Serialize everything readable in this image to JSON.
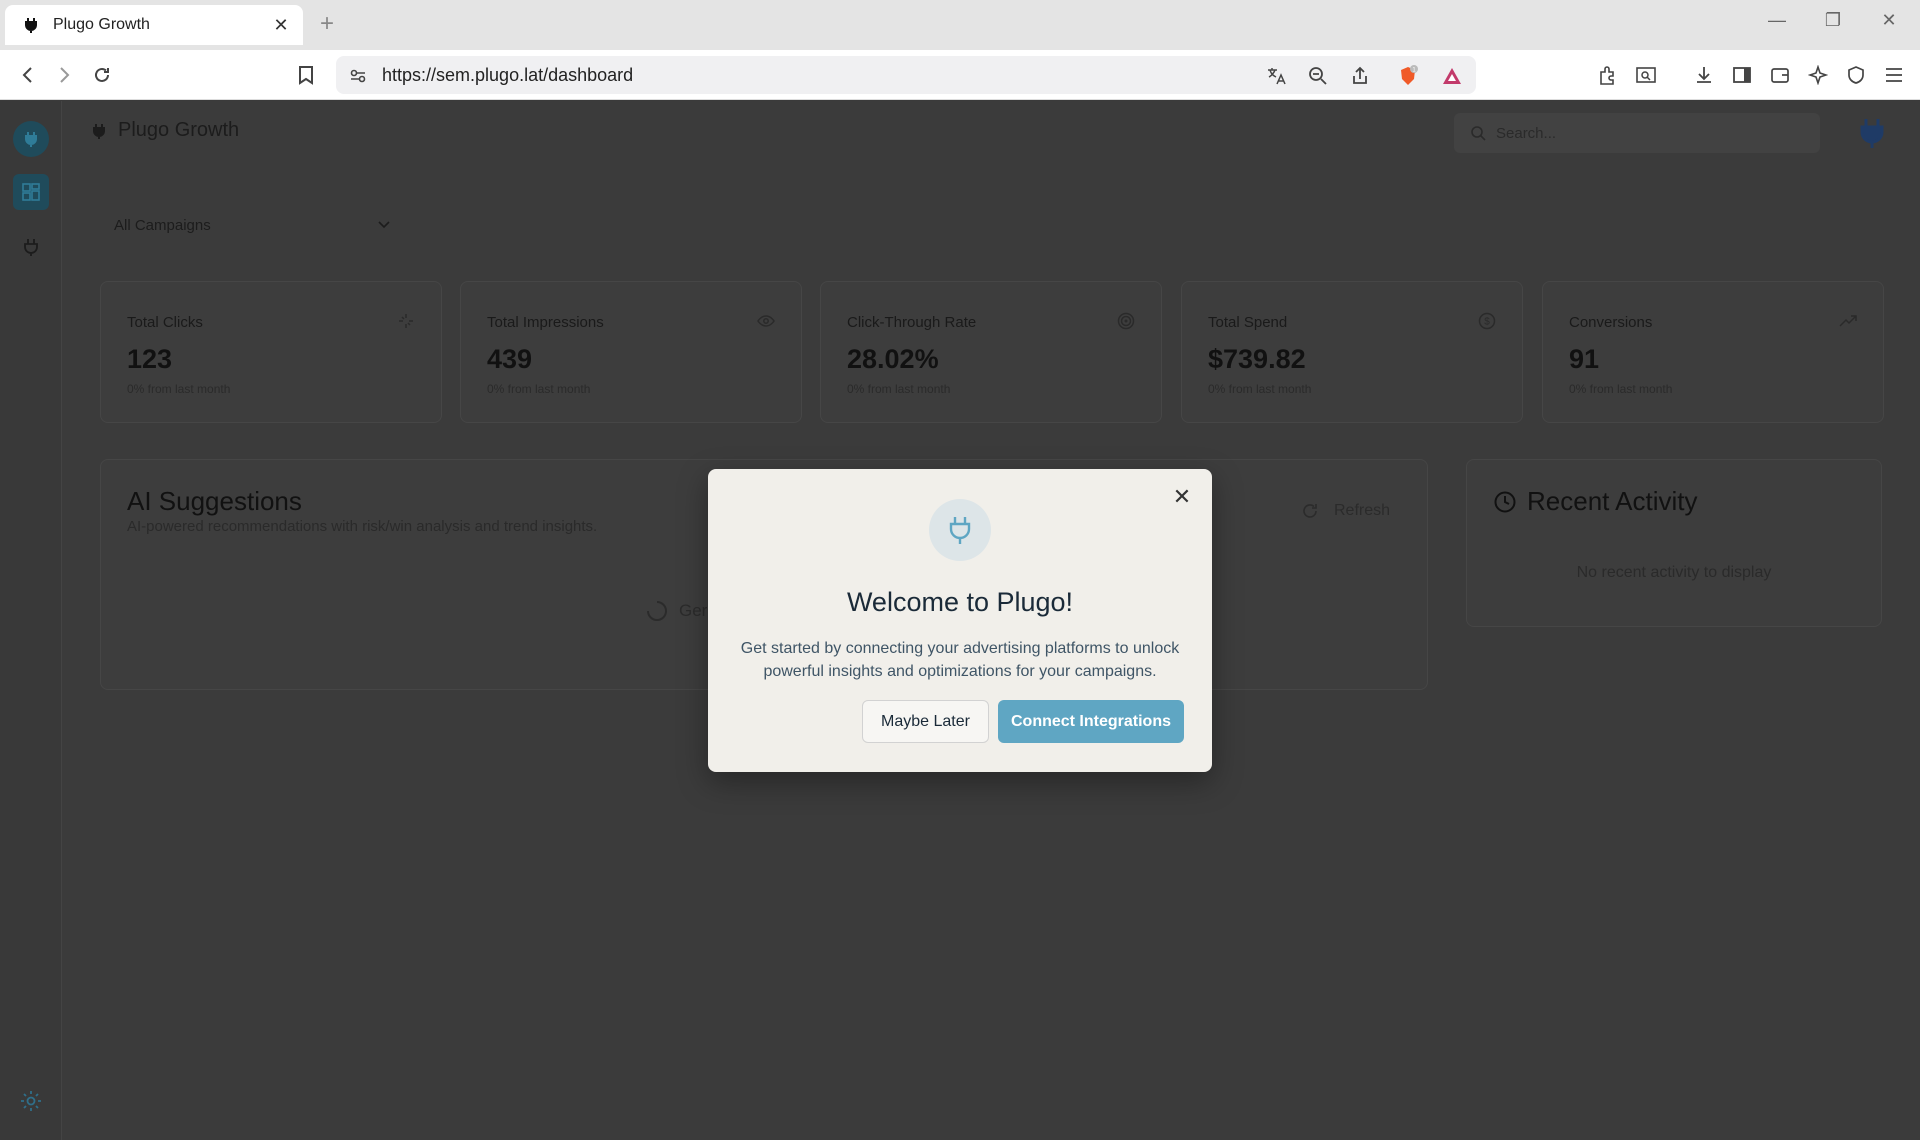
{
  "browser": {
    "tab_title": "Plugo Growth",
    "tab_close": "✕",
    "new_tab": "+",
    "url": "https://sem.plugo.lat/dashboard",
    "shield_badge": "1"
  },
  "app": {
    "brand": "Plugo Growth",
    "search_placeholder": "Search...",
    "campaign_select": "All Campaigns"
  },
  "metrics": [
    {
      "label": "Total Clicks",
      "value": "123",
      "sub": "0% from last month",
      "icon": "sparkle-icon"
    },
    {
      "label": "Total Impressions",
      "value": "439",
      "sub": "0% from last month",
      "icon": "eye-icon"
    },
    {
      "label": "Click-Through Rate",
      "value": "28.02%",
      "sub": "0% from last month",
      "icon": "target-icon"
    },
    {
      "label": "Total Spend",
      "value": "$739.82",
      "sub": "0% from last month",
      "icon": "dollar-circle-icon"
    },
    {
      "label": "Conversions",
      "value": "91",
      "sub": "0% from last month",
      "icon": "trending-up-icon"
    }
  ],
  "ai": {
    "title": "AI Suggestions",
    "subtitle": "AI-powered recommendations with risk/win analysis and trend insights.",
    "refresh": "Refresh",
    "loading": "Ger"
  },
  "recent": {
    "title": "Recent Activity",
    "empty": "No recent activity to display"
  },
  "modal": {
    "title": "Welcome to Plugo!",
    "body": "Get started by connecting your advertising platforms to unlock powerful insights and optimizations for your campaigns.",
    "later": "Maybe Later",
    "connect": "Connect Integrations",
    "close": "✕"
  },
  "colors": {
    "accent": "#5fa6c3",
    "overlay": "#3b3b3b",
    "modal_bg": "#f1efea"
  }
}
